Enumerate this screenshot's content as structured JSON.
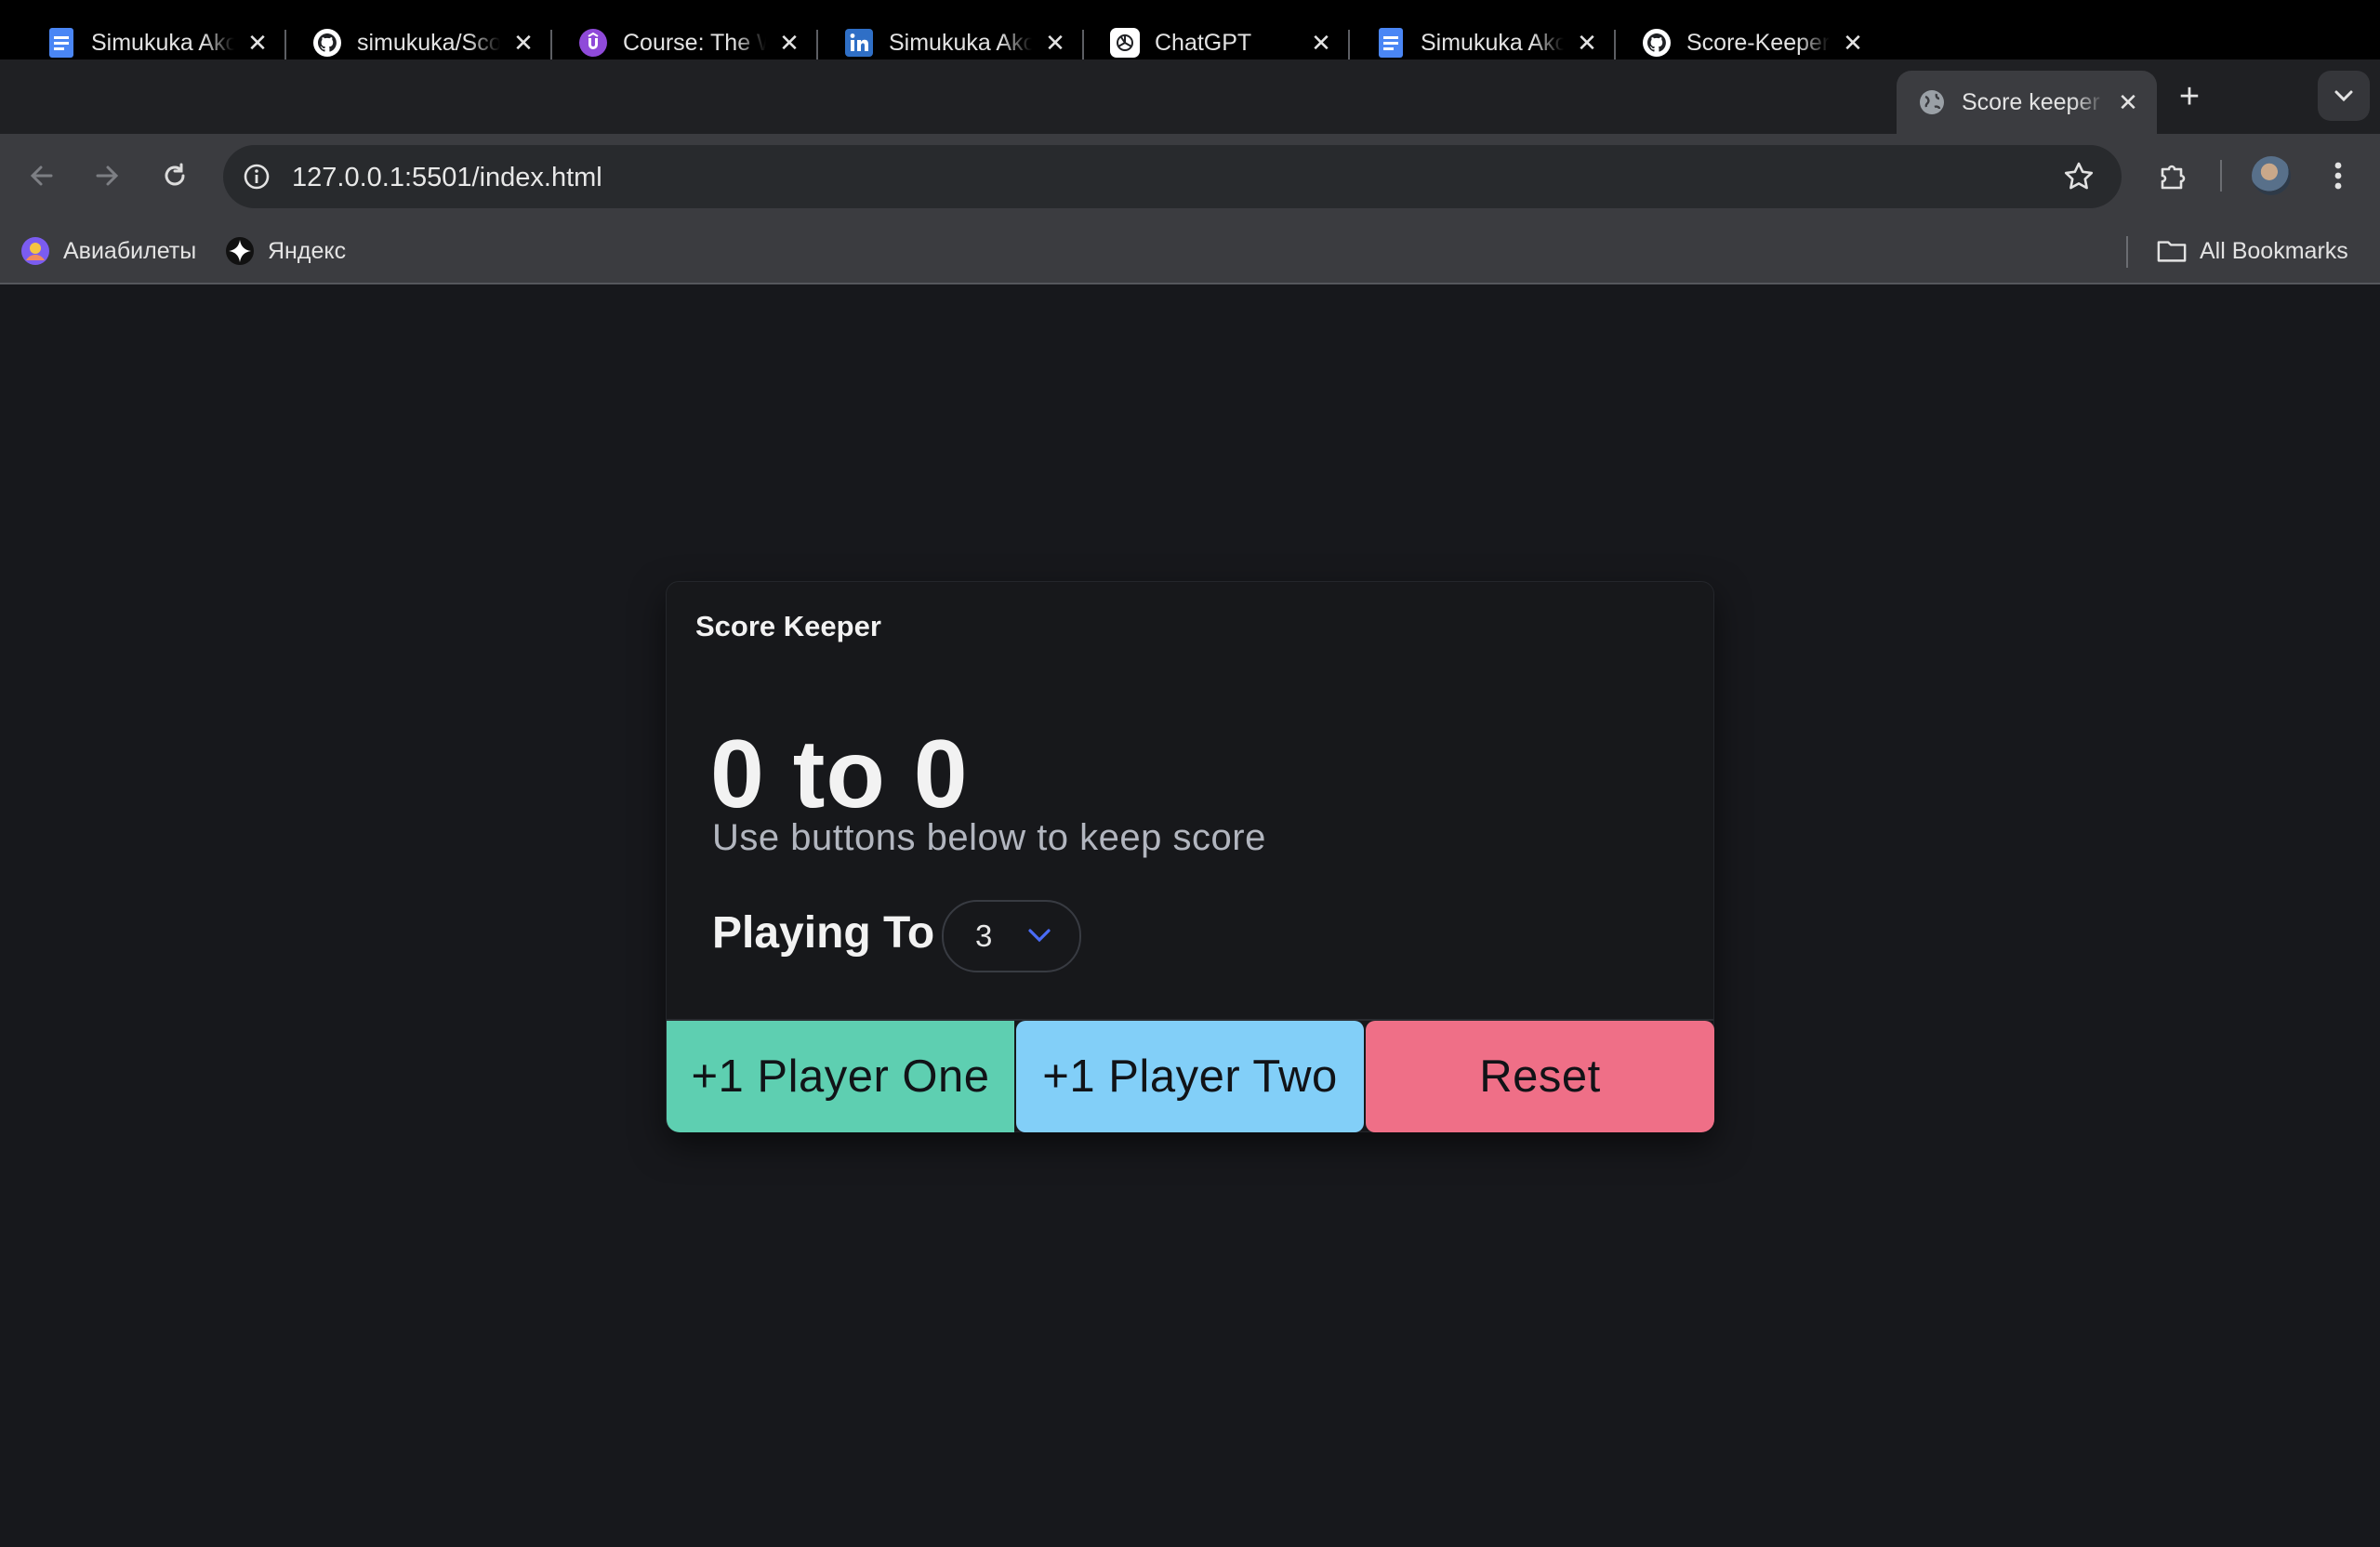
{
  "browser": {
    "tabs": [
      {
        "title": "Simukuka Akombelwa",
        "icon": "google-docs-icon",
        "active": false
      },
      {
        "title": "simukuka/Score-Keeper",
        "icon": "github-icon",
        "active": false
      },
      {
        "title": "Course: The Web Developer Bootcamp",
        "icon": "udemy-icon",
        "active": false
      },
      {
        "title": "Simukuka Akombelwa",
        "icon": "linkedin-icon",
        "active": false
      },
      {
        "title": "ChatGPT",
        "icon": "chatgpt-icon",
        "active": false
      },
      {
        "title": "Simukuka Akombelwa",
        "icon": "google-docs-icon",
        "active": false
      },
      {
        "title": "Score-Keeper",
        "icon": "github-icon",
        "active": false
      },
      {
        "title": "Score keeper",
        "icon": "globe-icon",
        "active": true
      }
    ],
    "address": {
      "url": "127.0.0.1:5501/index.html"
    },
    "bookmarks": [
      {
        "label": "Авиабилеты",
        "icon": "globe-avatar-icon"
      },
      {
        "label": "Яндекс",
        "icon": "yandex-star-icon"
      }
    ],
    "all_bookmarks_label": "All Bookmarks"
  },
  "app": {
    "header": "Score Keeper",
    "score_display": "0 to 0",
    "hint": "Use buttons below to keep score",
    "playing_to_label": "Playing To",
    "playing_to_value": "3",
    "buttons": {
      "player_one": "+1 Player One",
      "player_two": "+1 Player Two",
      "reset": "Reset"
    }
  },
  "colors": {
    "page_bg": "#17181c",
    "player_one": "#5ecfb1",
    "player_two": "#82cff8",
    "reset": "#ef6f87",
    "select_chevron": "#4a6cf7"
  }
}
